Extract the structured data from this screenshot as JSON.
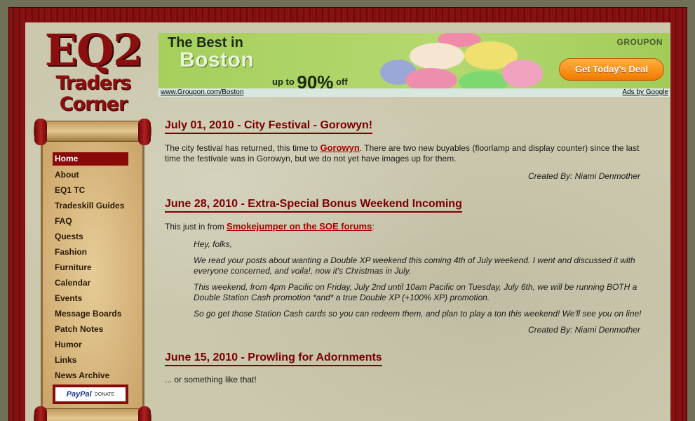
{
  "logo": {
    "line1": "EQ2",
    "line2": "Traders Corner"
  },
  "nav": {
    "items": [
      {
        "label": "Home"
      },
      {
        "label": "About"
      },
      {
        "label": "EQ1 TC"
      },
      {
        "label": "Tradeskill Guides"
      },
      {
        "label": "FAQ"
      },
      {
        "label": "Quests"
      },
      {
        "label": "Fashion"
      },
      {
        "label": "Furniture"
      },
      {
        "label": "Calendar"
      },
      {
        "label": "Events"
      },
      {
        "label": "Message Boards"
      },
      {
        "label": "Patch Notes"
      },
      {
        "label": "Humor"
      },
      {
        "label": "Links"
      },
      {
        "label": "News Archive"
      }
    ],
    "paypal": {
      "brand": "PayPal",
      "action": "DONATE"
    }
  },
  "ad": {
    "headline": "The Best in",
    "city": "Boston",
    "offer_prefix": "up to",
    "offer_value": "90%",
    "offer_suffix": "off",
    "brand": "GROUPON",
    "cta": "Get Today's Deal",
    "url": "www.Groupon.com/Boston",
    "ads_by": "Ads by Google"
  },
  "posts": [
    {
      "title": "July 01, 2010 - City Festival - Gorowyn!",
      "body_pre": "The city festival has returned, this time to ",
      "link": "Gorowyn",
      "body_post": ". There are two new buyables (floorlamp and display counter) since the last time the festivale was in Gorowyn, but we do not yet have images up for them.",
      "credit": "Created By: Niami Denmother"
    },
    {
      "title": "June 28, 2010 - Extra-Special Bonus Weekend Incoming",
      "body_pre": "This just in from ",
      "link": "Smokejumper on the SOE forums",
      "body_post": ":",
      "quote": [
        "Hey, folks,",
        "We read your posts about wanting a Double XP weekend this coming 4th of July weekend. I went and discussed it with everyone concerned, and voila!, now it's Christmas in July.",
        "This weekend, from 4pm Pacific on Friday, July 2nd until 10am Pacific on Tuesday, July 6th, we will be running BOTH a Double Station Cash promotion *and* a true Double XP (+100% XP) promotion.",
        "So go get those Station Cash cards so you can redeem them, and plan to play a ton this weekend! We'll see you on line!"
      ],
      "credit": "Created By: Niami Denmother"
    },
    {
      "title": "June 15, 2010 - Prowling for Adornments",
      "body_pre": "... or something like that!"
    }
  ]
}
